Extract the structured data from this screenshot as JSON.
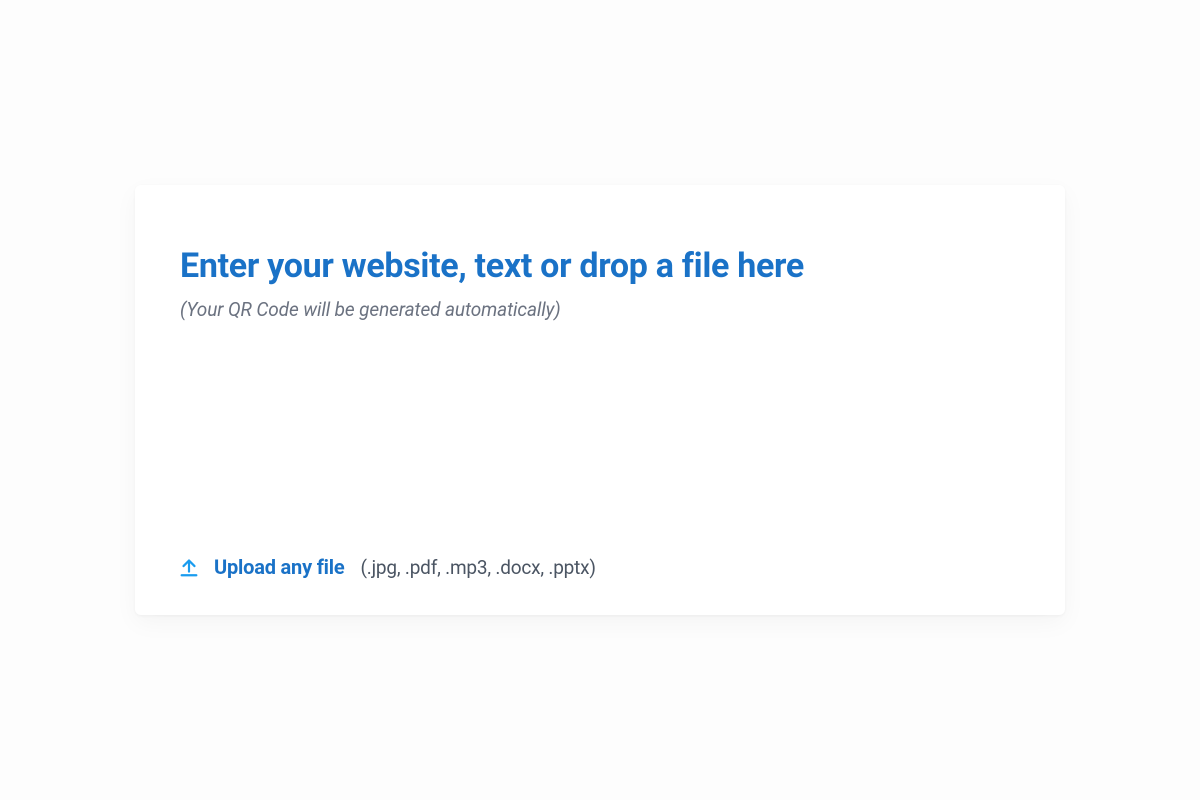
{
  "input": {
    "placeholder_title": "Enter your website, text or drop a file here",
    "placeholder_sub": "(Your QR Code will be generated automatically)"
  },
  "upload": {
    "label": "Upload any file",
    "hint": "(.jpg, .pdf, .mp3, .docx, .pptx)"
  }
}
